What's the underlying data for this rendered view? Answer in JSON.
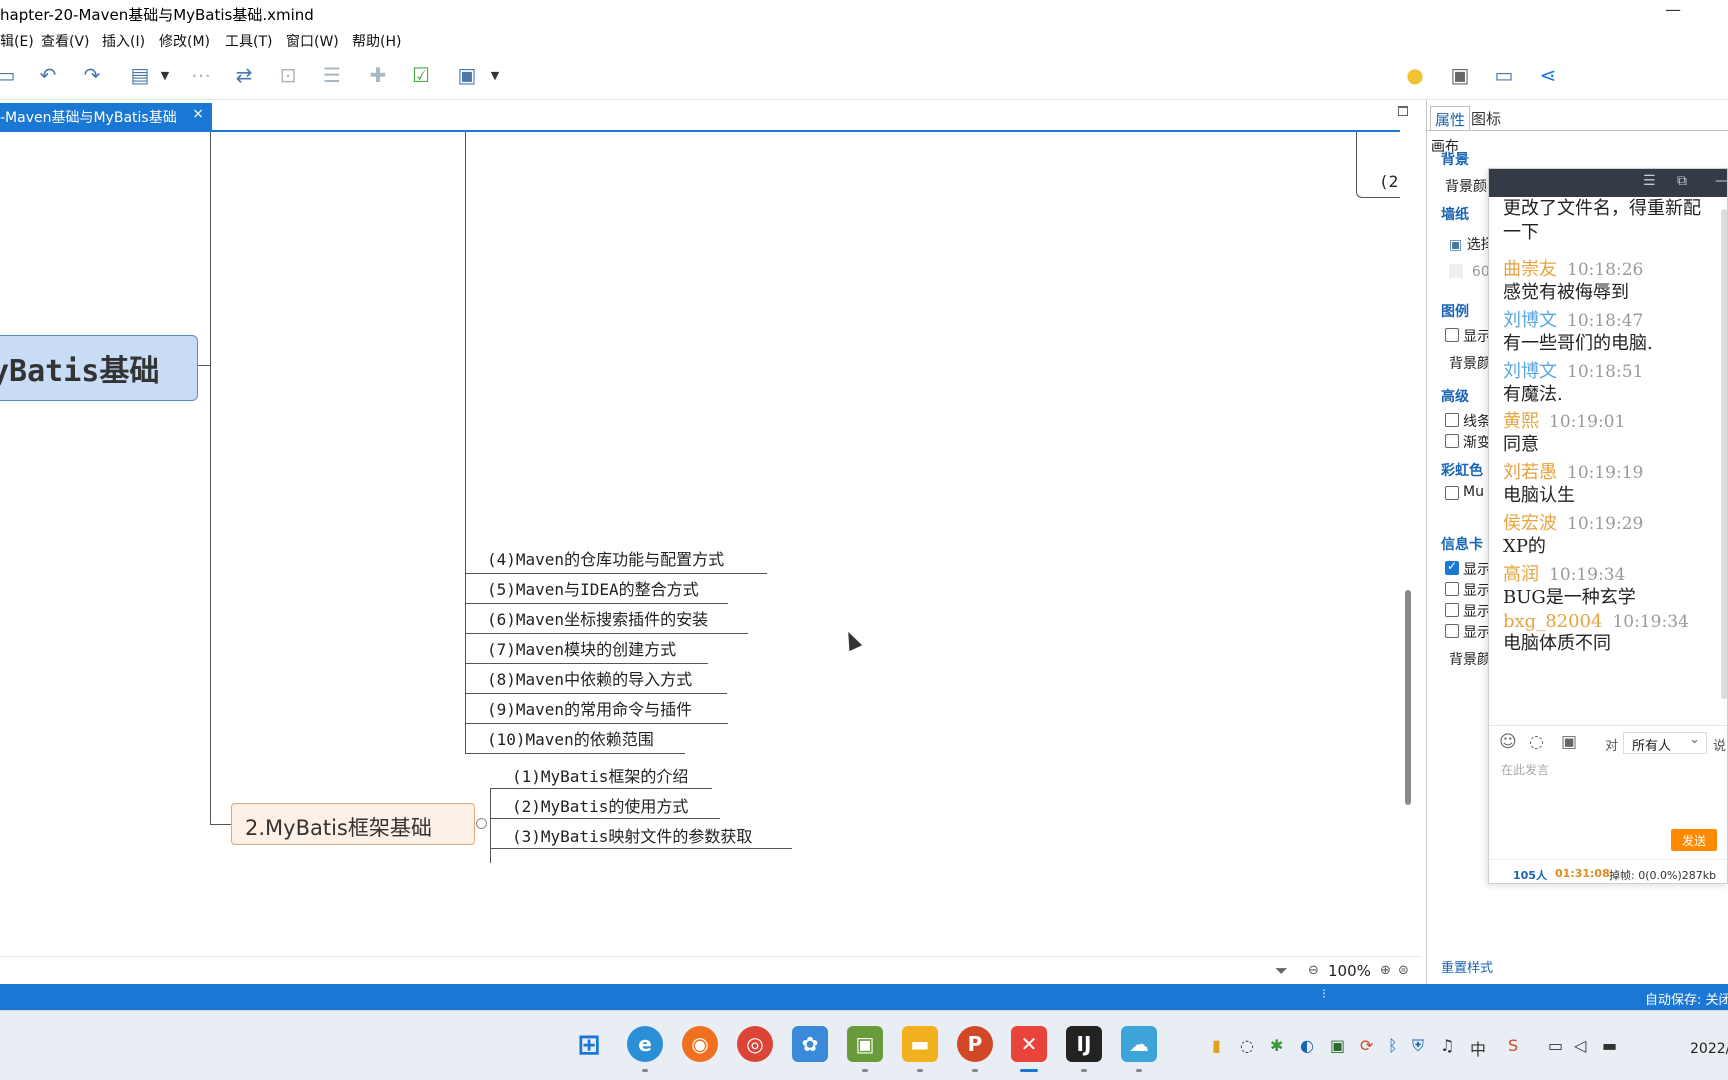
{
  "window": {
    "title": "hapter-20-Maven基础与MyBatis基础.xmind",
    "minimize": "—"
  },
  "menu": [
    "辑(E)",
    "查看(V)",
    "插入(I)",
    "修改(M)",
    "工具(T)",
    "窗口(W)",
    "帮助(H)"
  ],
  "tab": {
    "label": "-Maven基础与MyBatis基础",
    "close": "×"
  },
  "mindmap": {
    "root": "yBatis基础",
    "right_partial": "(2",
    "maven_items": [
      "(4)Maven的仓库功能与配置方式",
      "(5)Maven与IDEA的整合方式",
      "(6)Maven坐标搜索插件的安装",
      "(7)Maven模块的创建方式",
      "(8)Maven中依赖的导入方式",
      "(9)Maven的常用命令与插件",
      "(10)Maven的依赖范围"
    ],
    "mybatis_topic": "2.MyBatis框架基础",
    "mybatis_items": [
      "(1)MyBatis框架的介绍",
      "(2)MyBatis的使用方式",
      "(3)MyBatis映射文件的参数获取"
    ]
  },
  "zoom": {
    "value": "100%",
    "minus": "⊖",
    "plus": "⊕",
    "fit": "⊜"
  },
  "statusbar": {
    "autosave": "自动保存: 关闭"
  },
  "properties": {
    "tabs": [
      "属性",
      "图标"
    ],
    "canvas_label": "画布",
    "sections": {
      "background": "背景",
      "background_color": "背景颜",
      "wallpaper": "墙纸",
      "select": "选择",
      "opacity": "60",
      "legend": "图例",
      "legend_show": "显示",
      "legend_bg": "背景颜",
      "advanced": "高级",
      "adv_line": "线条",
      "adv_gradient": "渐变",
      "rainbow": "彩虹色",
      "rainbow_mu": "Mu",
      "info_card": "信息卡",
      "info_show1": "显示",
      "info_show2": "显示",
      "info_show3": "显示",
      "info_show4": "显示",
      "info_bg": "背景颜"
    },
    "reset": "重置样式"
  },
  "chat": {
    "messages": [
      {
        "name": "",
        "time": "",
        "text": "更改了文件名，得重新配",
        "text2": "一下",
        "color": "#222222"
      },
      {
        "name": "曲崇友",
        "time": "10:18:26",
        "text": "感觉有被侮辱到",
        "color": "#e7a33e"
      },
      {
        "name": "刘博文",
        "time": "10:18:47",
        "text": "有一些哥们的电脑.",
        "color": "#5aa5e0"
      },
      {
        "name": "刘博文",
        "time": "10:18:51",
        "text": "有魔法.",
        "color": "#5aa5e0"
      },
      {
        "name": "黄熙",
        "time": "10:19:01",
        "text": "同意",
        "color": "#e7a33e"
      },
      {
        "name": "刘若愚",
        "time": "10:19:19",
        "text": "电脑认生",
        "color": "#e7a33e"
      },
      {
        "name": "侯宏波",
        "time": "10:19:29",
        "text": "XP的",
        "color": "#e7a33e"
      },
      {
        "name": "高润",
        "time": "10:19:34",
        "text": "BUG是一种玄学",
        "color": "#e7a33e"
      },
      {
        "name": "bxg_82004",
        "time": "10:19:34",
        "text": "电脑体质不同",
        "color": "#e7a33e"
      }
    ],
    "to_label": "对",
    "recipient": "所有人",
    "say_label": "说：",
    "placeholder": "在此发言",
    "send": "发送",
    "footer": {
      "people": "105人",
      "duration": "01:31:08",
      "frames": "掉帧: 0(0.0%)287kb"
    }
  },
  "taskbar": {
    "clock": "2022/"
  }
}
